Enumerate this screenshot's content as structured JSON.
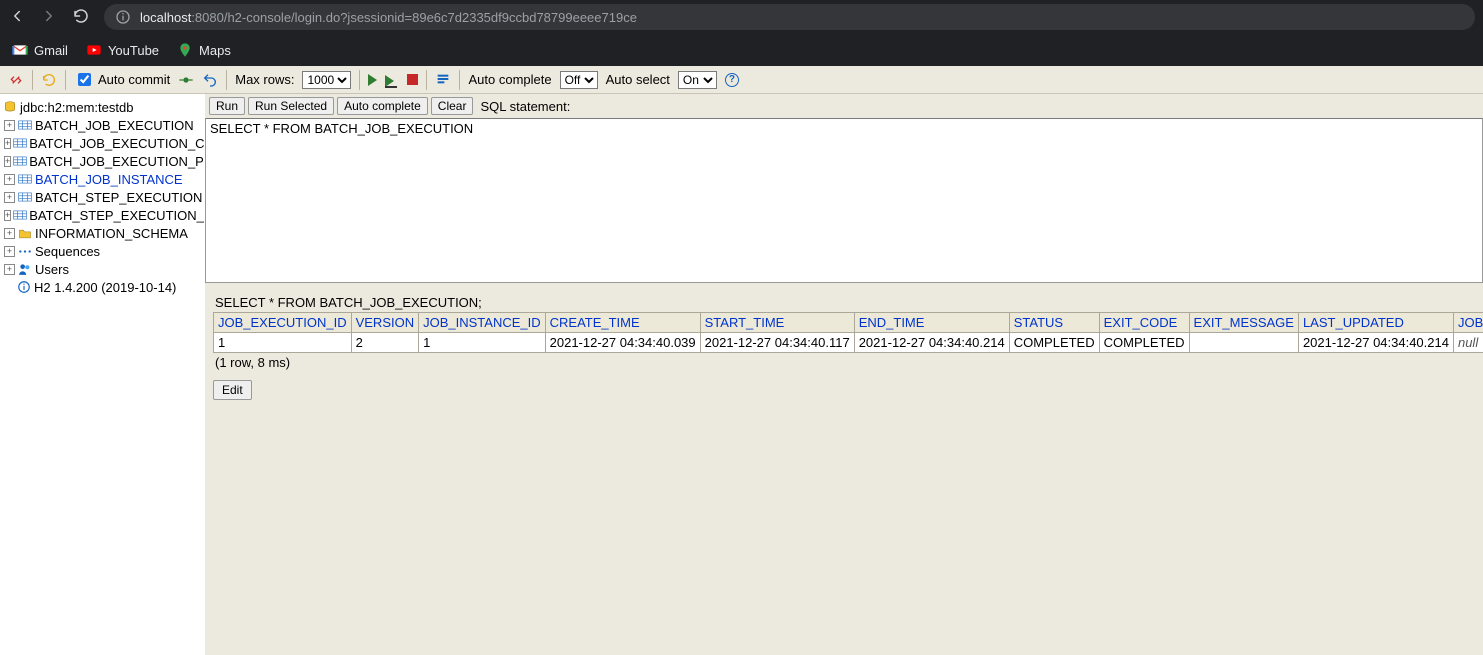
{
  "browser": {
    "url_host": "localhost",
    "url_rest": ":8080/h2-console/login.do?jsessionid=89e6c7d2335df9ccbd78799eeee719ce",
    "bookmarks": [
      {
        "label": "Gmail",
        "icon": "gmail-icon"
      },
      {
        "label": "YouTube",
        "icon": "youtube-icon"
      },
      {
        "label": "Maps",
        "icon": "maps-icon"
      }
    ]
  },
  "toolbar": {
    "auto_commit_label": "Auto commit",
    "auto_commit_checked": true,
    "max_rows_label": "Max rows:",
    "max_rows_value": "1000",
    "auto_complete_label": "Auto complete",
    "auto_complete_value": "Off",
    "auto_select_label": "Auto select",
    "auto_select_value": "On"
  },
  "sidebar": {
    "db_url": "jdbc:h2:mem:testdb",
    "items": [
      {
        "label": "BATCH_JOB_EXECUTION",
        "link": false
      },
      {
        "label": "BATCH_JOB_EXECUTION_C",
        "link": false
      },
      {
        "label": "BATCH_JOB_EXECUTION_P",
        "link": false
      },
      {
        "label": "BATCH_JOB_INSTANCE",
        "link": true
      },
      {
        "label": "BATCH_STEP_EXECUTION",
        "link": false
      },
      {
        "label": "BATCH_STEP_EXECUTION_",
        "link": false
      }
    ],
    "info_schema": "INFORMATION_SCHEMA",
    "sequences": "Sequences",
    "users": "Users",
    "version": "H2 1.4.200 (2019-10-14)"
  },
  "cmd": {
    "run": "Run",
    "run_selected": "Run Selected",
    "auto_complete": "Auto complete",
    "clear": "Clear",
    "sql_label": "SQL statement:"
  },
  "editor": {
    "sql": "SELECT * FROM BATCH_JOB_EXECUTION "
  },
  "result": {
    "echo_sql": "SELECT * FROM BATCH_JOB_EXECUTION;",
    "columns": [
      "JOB_EXECUTION_ID",
      "VERSION",
      "JOB_INSTANCE_ID",
      "CREATE_TIME",
      "START_TIME",
      "END_TIME",
      "STATUS",
      "EXIT_CODE",
      "EXIT_MESSAGE",
      "LAST_UPDATED",
      "JOB_CONFIGURATION"
    ],
    "rows": [
      [
        "1",
        "2",
        "1",
        "2021-12-27 04:34:40.039",
        "2021-12-27 04:34:40.117",
        "2021-12-27 04:34:40.214",
        "COMPLETED",
        "COMPLETED",
        "",
        "2021-12-27 04:34:40.214",
        "null"
      ]
    ],
    "stats": "(1 row, 8 ms)",
    "edit": "Edit"
  }
}
